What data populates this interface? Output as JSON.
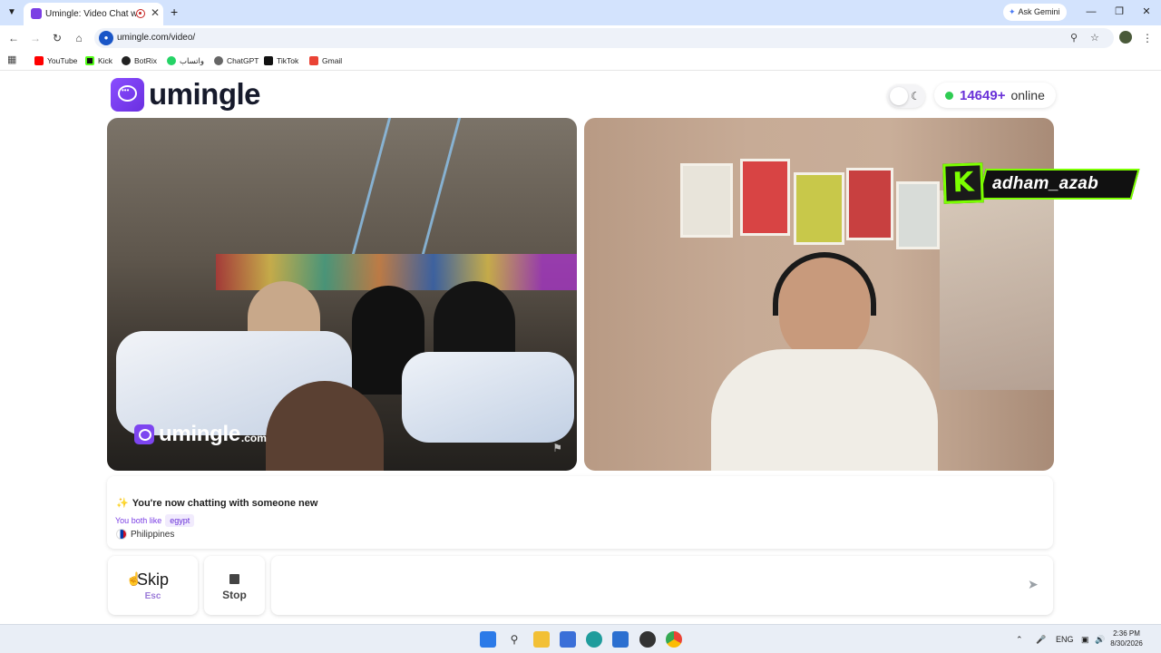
{
  "browser": {
    "tab_title": "Umingle: Video Chat with S",
    "new_tab_icon": "plus-icon",
    "ask_gemini": "Ask Gemini",
    "url": "umingle.com/video/",
    "accent": "#d3e3fd"
  },
  "bookmarks": [
    {
      "label": "YouTube",
      "color": "#ff0000"
    },
    {
      "label": "Kick",
      "color": "#53fc18"
    },
    {
      "label": "BotRix",
      "color": "#222222"
    },
    {
      "label": "واتساب",
      "color": "#25d366"
    },
    {
      "label": "ChatGPT",
      "color": "#555555"
    },
    {
      "label": "TikTok",
      "color": "#111111"
    },
    {
      "label": "Gmail",
      "color": "#ea4335"
    }
  ],
  "header": {
    "logo_text": "umingle",
    "online_count": "14649+",
    "online_label": "online",
    "brand_color": "#7b3fe4",
    "online_dot_color": "#2ecc52"
  },
  "videos": {
    "watermark_text": "umingle",
    "watermark_suffix": ".com",
    "streamer_badge_letter": "K",
    "streamer_badge_name": "adham_azab"
  },
  "chat": {
    "status_message": "You're now chatting with someone new",
    "likes_label": "You both like",
    "likes_tag": "egypt",
    "country": "Philippines"
  },
  "controls": {
    "skip_label": "Skip",
    "skip_key": "Esc",
    "stop_label": "Stop",
    "input_placeholder": ""
  },
  "taskbar": {
    "lang": "ENG",
    "time": "2:36 PM",
    "date": "8/30/2026"
  }
}
